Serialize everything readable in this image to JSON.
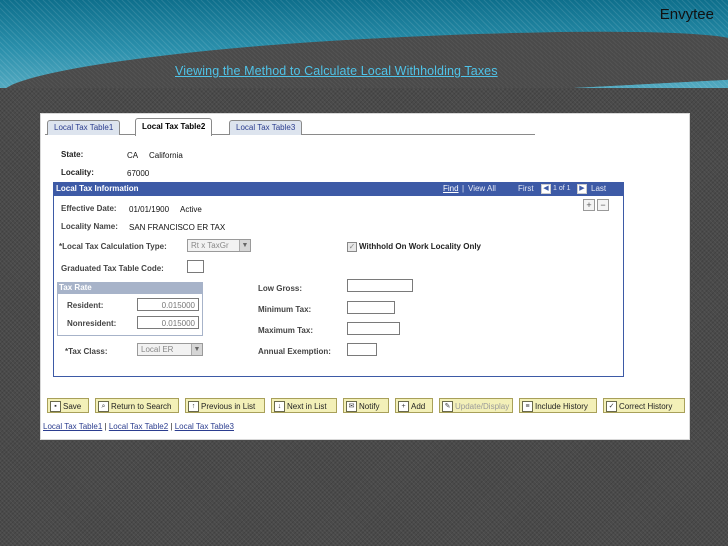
{
  "slide": {
    "brand": "Envytee",
    "title": "Viewing the Method to Calculate Local Withholding Taxes"
  },
  "tabs": [
    {
      "label": "Local Tax Table1"
    },
    {
      "label": "Local Tax Table2"
    },
    {
      "label": "Local Tax Table3"
    }
  ],
  "header": {
    "state_label": "State:",
    "state_code": "CA",
    "state_name": "California",
    "locality_label": "Locality:",
    "locality_value": "67000"
  },
  "section": {
    "title": "Local Tax Information",
    "find": "Find",
    "view_all": "View All",
    "first": "First",
    "counter": "1 of 1",
    "last": "Last",
    "add_row": "+",
    "delete_row": "−"
  },
  "form": {
    "effective_date_label": "Effective Date:",
    "effective_date": "01/01/1900",
    "status": "Active",
    "locality_name_label": "Locality Name:",
    "locality_name": "SAN FRANCISCO ER TAX",
    "calc_type_label": "*Local Tax Calculation Type:",
    "calc_type_value": "Rt x TaxGr",
    "withhold_label": "Withhold On Work Locality Only",
    "withhold_checked": true,
    "graduated_label": "Graduated Tax Table Code:",
    "graduated_value": "",
    "tax_rate_title": "Tax Rate",
    "resident_label": "Resident:",
    "resident_value": "0.015000",
    "nonresident_label": "Nonresident:",
    "nonresident_value": "0.015000",
    "tax_class_label": "*Tax Class:",
    "tax_class_value": "Local ER",
    "low_gross_label": "Low Gross:",
    "low_gross_value": "",
    "min_tax_label": "Minimum Tax:",
    "min_tax_value": "",
    "max_tax_label": "Maximum Tax:",
    "max_tax_value": "",
    "annual_exemption_label": "Annual Exemption:",
    "annual_exemption_value": ""
  },
  "toolbar": {
    "save": "Save",
    "return": "Return to Search",
    "previous": "Previous in List",
    "next": "Next in List",
    "notify": "Notify",
    "add": "Add",
    "update": "Update/Display",
    "include_history": "Include History",
    "correct_history": "Correct History"
  },
  "bottom_links": {
    "link1": "Local Tax Table1",
    "sep": " | ",
    "link2": "Local Tax Table2",
    "link3": "Local Tax Table3"
  },
  "colors": {
    "banner": "#1b7f9c",
    "section_header": "#3d5aa6",
    "button_bg": "#f3f0b8",
    "title_link": "#4fc3e8"
  }
}
